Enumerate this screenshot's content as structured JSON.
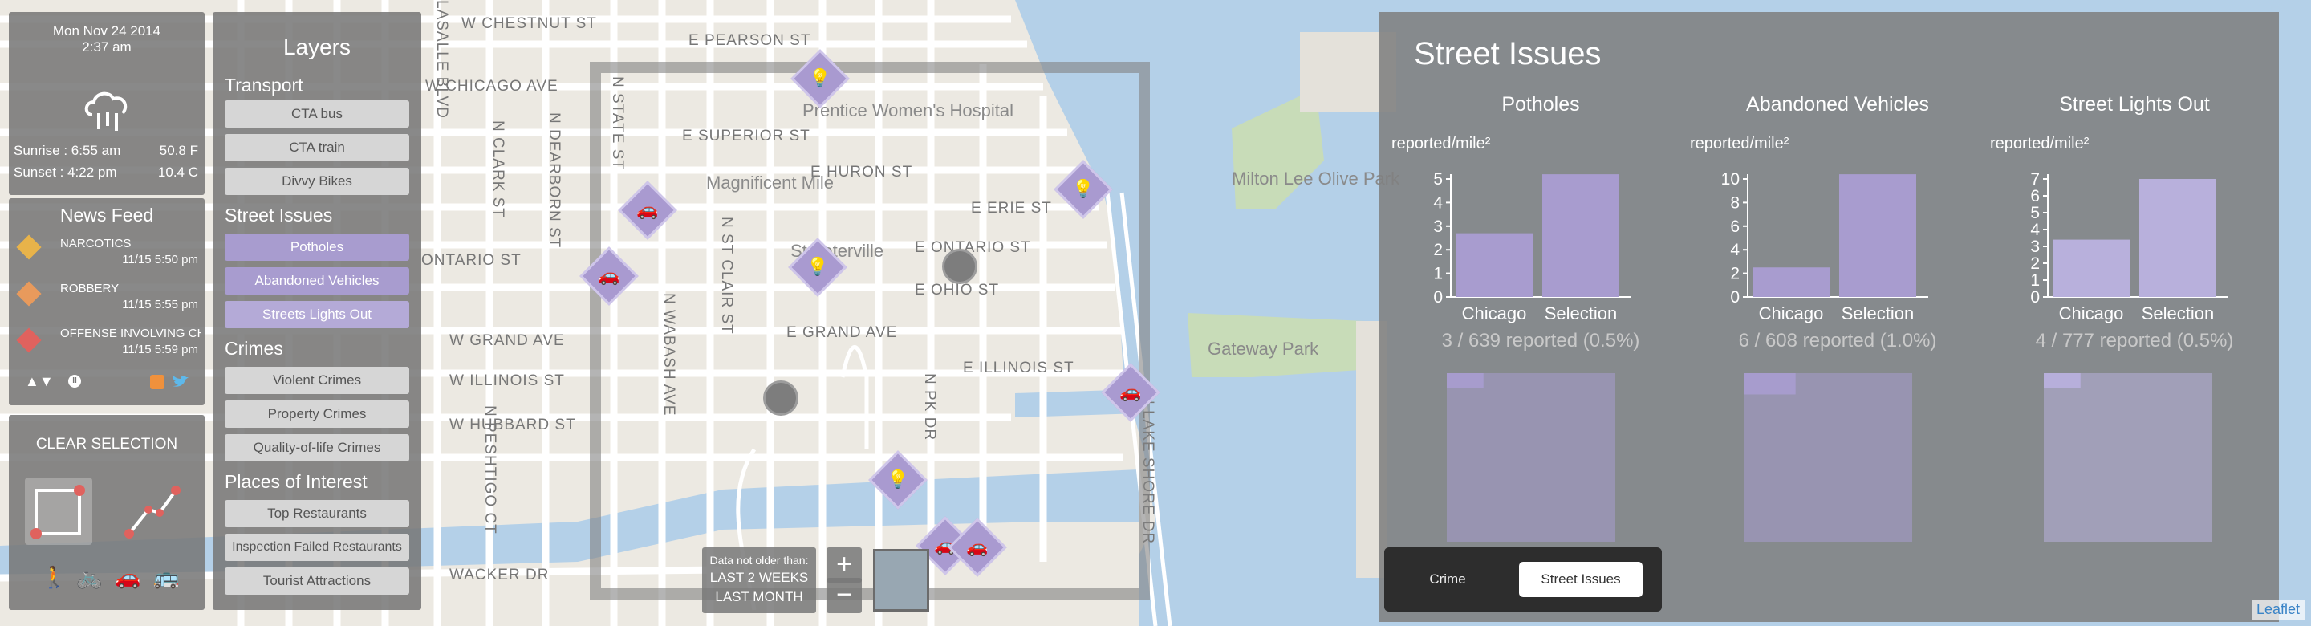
{
  "weather": {
    "date": "Mon Nov 24 2014",
    "time": "2:37 am",
    "icon": "rain-cloud-icon",
    "sunrise_label": "Sunrise : 6:55 am",
    "sunset_label": "Sunset : 4:22 pm",
    "temp_high": "50.8 F",
    "temp_low": "10.4 C"
  },
  "news": {
    "title": "News Feed",
    "items": [
      {
        "title": "NARCOTICS",
        "time": "11/15 5:50 pm",
        "icon_color": "#e8b34a",
        "icon": "warning-icon"
      },
      {
        "title": "ROBBERY",
        "time": "11/15 5:55 pm",
        "icon_color": "#e89a5c",
        "icon": "money-bag-icon"
      },
      {
        "title": "OFFENSE INVOLVING CH",
        "time": "11/15 5:59 pm",
        "icon_color": "#e0625e",
        "icon": "gun-icon"
      }
    ],
    "footer_arrows": "▲▼",
    "footer_pause": "II"
  },
  "tools": {
    "clear_label": "CLEAR SELECTION",
    "modes": [
      "walk",
      "bike",
      "car",
      "bus"
    ]
  },
  "layers": {
    "title": "Layers",
    "sections": [
      {
        "title": "Transport",
        "items": [
          {
            "label": "CTA bus",
            "state": "off"
          },
          {
            "label": "CTA train",
            "state": "off"
          },
          {
            "label": "Divvy Bikes",
            "state": "off"
          }
        ]
      },
      {
        "title": "Street Issues",
        "items": [
          {
            "label": "Potholes",
            "state": "on"
          },
          {
            "label": "Abandoned Vehicles",
            "state": "on"
          },
          {
            "label": "Streets Lights Out",
            "state": "on2"
          }
        ]
      },
      {
        "title": "Crimes",
        "items": [
          {
            "label": "Violent Crimes",
            "state": "off"
          },
          {
            "label": "Property Crimes",
            "state": "off"
          },
          {
            "label": "Quality-of-life Crimes",
            "state": "off"
          }
        ]
      },
      {
        "title": "Places of Interest",
        "items": [
          {
            "label": "Top Restaurants",
            "state": "off"
          },
          {
            "label": "Inspection Failed Restaurants",
            "state": "off"
          },
          {
            "label": "Tourist Attractions",
            "state": "off"
          }
        ]
      }
    ]
  },
  "map": {
    "street_labels": [
      "W CHESTNUT ST",
      "E PEARSON ST",
      "W CHICAGO AVE",
      "E SUPERIOR ST",
      "E HURON ST",
      "E ERIE ST",
      "E ONTARIO ST",
      "E OHIO ST",
      "E GRAND AVE",
      "E ILLINOIS ST",
      "W GRAND AVE",
      "W ILLINOIS ST",
      "W HUBBARD ST",
      "WACKER DR",
      "ONTARIO ST",
      "N STATE ST",
      "N CLARK ST",
      "N DEARBORN ST",
      "N WABASH AVE",
      "N PESHTIGO CT",
      "N ST CLAIR ST",
      "N LAKE SHORE DR",
      "LASALLE BLVD",
      "N PK DR"
    ],
    "place_labels": [
      "Magnificent Mile",
      "Streeterville",
      "Milton Lee Olive Park",
      "Gateway Park",
      "Prentice Women's Hospital"
    ],
    "markers": [
      {
        "type": "streetlight",
        "glyph": "💡"
      },
      {
        "type": "abandoned-vehicle",
        "glyph": "🚗"
      },
      {
        "type": "abandoned-vehicle",
        "glyph": "🚗"
      },
      {
        "type": "streetlight",
        "glyph": "💡"
      },
      {
        "type": "streetlight",
        "glyph": "💡"
      },
      {
        "type": "abandoned-vehicle",
        "glyph": "🚗"
      },
      {
        "type": "streetlight",
        "glyph": "💡"
      },
      {
        "type": "abandoned-vehicle",
        "glyph": "🚗"
      },
      {
        "type": "abandoned-vehicle",
        "glyph": "🚗"
      }
    ],
    "attribution": "Leaflet"
  },
  "time_filter": {
    "label": "Data not older than:",
    "option1": "LAST 2 WEEKS",
    "option2": "LAST MONTH",
    "zoom_in": "+",
    "zoom_out": "−"
  },
  "stats": {
    "title": "Street Issues",
    "tabs": {
      "crime": "Crime",
      "street_issues": "Street Issues",
      "active": "street_issues"
    },
    "bar_color": "#a89ccf",
    "bar_color2": "#b8b0dc"
  },
  "chart_data": [
    {
      "type": "bar",
      "title": "Potholes",
      "ylabel": "reported/mile²",
      "categories": [
        "Chicago",
        "Selection"
      ],
      "values": [
        2.7,
        5.2
      ],
      "ylim": [
        0,
        5
      ],
      "yticks": [
        0,
        1,
        2,
        3,
        4,
        5
      ],
      "summary": "3 / 639 reported (0.5%)",
      "fraction": 0.005
    },
    {
      "type": "bar",
      "title": "Abandoned Vehicles",
      "ylabel": "reported/mile²",
      "categories": [
        "Chicago",
        "Selection"
      ],
      "values": [
        2.5,
        10.4
      ],
      "ylim": [
        0,
        10
      ],
      "yticks": [
        0,
        2,
        4,
        6,
        8,
        10
      ],
      "summary": "6 / 608 reported (1.0%)",
      "fraction": 0.01
    },
    {
      "type": "bar",
      "title": "Street Lights Out",
      "ylabel": "reported/mile²",
      "categories": [
        "Chicago",
        "Selection"
      ],
      "values": [
        3.4,
        7.0
      ],
      "ylim": [
        0,
        7
      ],
      "yticks": [
        0,
        1,
        2,
        3,
        4,
        5,
        6,
        7
      ],
      "summary": "4 / 777 reported (0.5%)",
      "fraction": 0.005
    }
  ]
}
